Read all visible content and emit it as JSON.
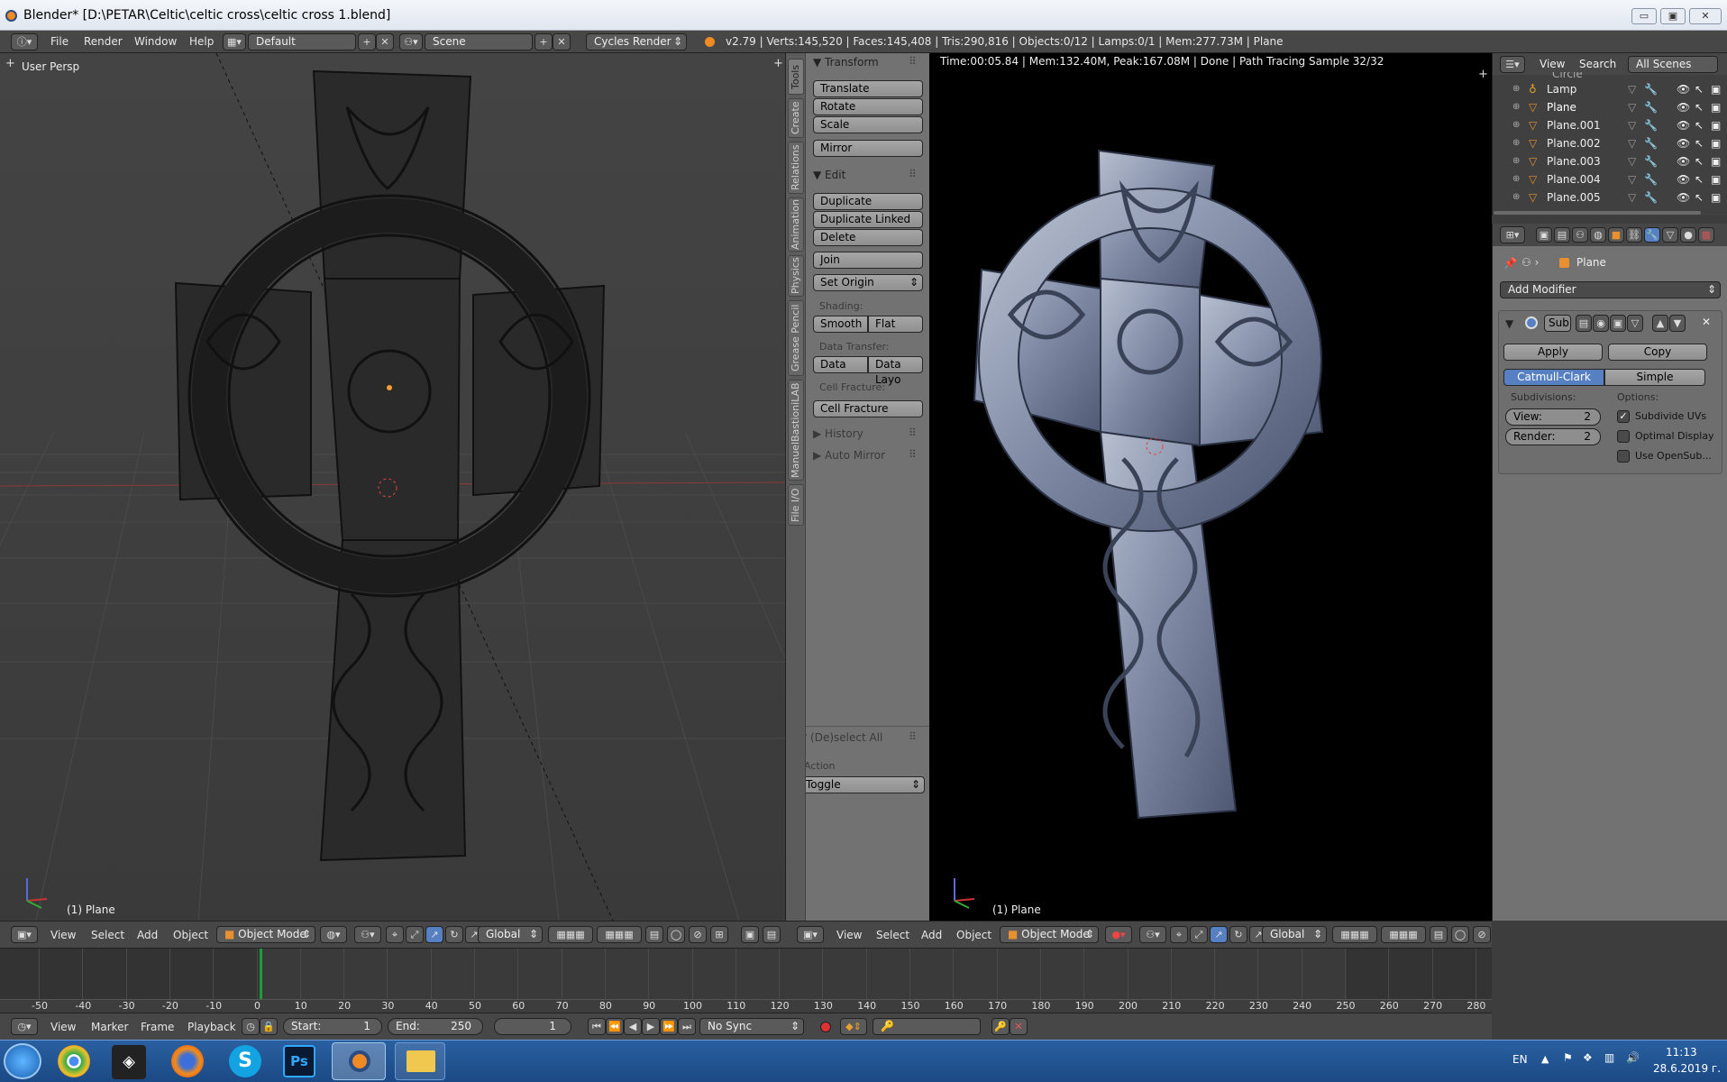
{
  "window": {
    "title": "Blender* [D:\\PETAR\\Celtic\\celtic cross\\celtic cross 1.blend]",
    "minimize": "▭",
    "maximize": "▣",
    "close": "✕"
  },
  "infobar": {
    "menus": [
      "File",
      "Render",
      "Window",
      "Help"
    ],
    "layout": "Default",
    "scene": "Scene",
    "engine": "Cycles Render",
    "stats": "v2.79 | Verts:145,520 | Faces:145,408 | Tris:290,816 | Objects:0/12 | Lamps:0/1 | Mem:277.73M | Plane"
  },
  "viewport_left": {
    "label": "User Persp",
    "object": "(1) Plane"
  },
  "viewport_right": {
    "render_status": "Time:00:05.84 | Mem:132.40M, Peak:167.08M | Done | Path Tracing Sample 32/32",
    "object": "(1) Plane"
  },
  "tool_tabs": [
    "Tools",
    "Create",
    "Relations",
    "Animation",
    "Physics",
    "Grease Pencil",
    "ManuelBastioniLAB",
    "File I/O"
  ],
  "toolshelf": {
    "transform_title": "Transform",
    "translate": "Translate",
    "rotate": "Rotate",
    "scale": "Scale",
    "mirror": "Mirror",
    "edit_title": "Edit",
    "duplicate": "Duplicate",
    "duplicate_linked": "Duplicate Linked",
    "delete": "Delete",
    "join": "Join",
    "set_origin": "Set Origin",
    "shading_label": "Shading:",
    "smooth": "Smooth",
    "flat": "Flat",
    "data_transfer_label": "Data Transfer:",
    "data": "Data",
    "data_layo": "Data Layo",
    "cell_fracture_label": "Cell Fracture:",
    "cell_fracture": "Cell Fracture",
    "history": "History",
    "auto_mirror": "Auto Mirror",
    "deselect_title": "(De)select All",
    "action_label": "Action",
    "action_value": "Toggle"
  },
  "outliner": {
    "view": "View",
    "search": "Search",
    "scenes": "All Scenes",
    "partial_item": "Circle",
    "items": [
      {
        "name": "Lamp",
        "icon": "lamp-icon",
        "color": "#e0a030"
      },
      {
        "name": "Plane",
        "icon": "mesh-icon",
        "color": "#e89030"
      },
      {
        "name": "Plane.001",
        "icon": "mesh-icon",
        "color": "#e89030"
      },
      {
        "name": "Plane.002",
        "icon": "mesh-icon",
        "color": "#e89030"
      },
      {
        "name": "Plane.003",
        "icon": "mesh-icon",
        "color": "#e89030"
      },
      {
        "name": "Plane.004",
        "icon": "mesh-icon",
        "color": "#e89030"
      },
      {
        "name": "Plane.005",
        "icon": "mesh-icon",
        "color": "#e89030"
      }
    ]
  },
  "properties": {
    "object_name": "Plane",
    "add_modifier": "Add Modifier",
    "modifier_name": "Sub",
    "apply": "Apply",
    "copy": "Copy",
    "catmull_clark": "Catmull-Clark",
    "simple": "Simple",
    "subdivisions_label": "Subdivisions:",
    "options_label": "Options:",
    "view_label": "View:",
    "view_value": "2",
    "render_label": "Render:",
    "render_value": "2",
    "subdivide_uvs": "Subdivide UVs",
    "subdivide_uvs_checked": true,
    "optimal_display": "Optimal Display",
    "use_opensub": "Use OpenSub..."
  },
  "viewport_header": {
    "menus": [
      "View",
      "Select",
      "Add",
      "Object"
    ],
    "mode": "Object Mode",
    "orientation": "Global"
  },
  "timeline": {
    "ticks": [
      "-50",
      "-40",
      "-30",
      "-20",
      "-10",
      "0",
      "10",
      "20",
      "30",
      "40",
      "50",
      "60",
      "70",
      "80",
      "90",
      "100",
      "110",
      "120",
      "130",
      "140",
      "150",
      "160",
      "170",
      "180",
      "190",
      "200",
      "210",
      "220",
      "230",
      "240",
      "250",
      "260",
      "270",
      "280"
    ],
    "current_frame_marker": 0,
    "menus": [
      "View",
      "Marker",
      "Frame",
      "Playback"
    ],
    "start_label": "Start:",
    "start_value": "1",
    "end_label": "End:",
    "end_value": "250",
    "current": "1",
    "sync": "No Sync"
  },
  "taskbar": {
    "lang": "EN",
    "time": "11:13",
    "date": "28.6.2019 г.",
    "apps": [
      "chrome",
      "unity",
      "firefox",
      "skype",
      "photoshop",
      "blender",
      "explorer"
    ]
  },
  "colors": {
    "accent_blue": "#5680c2",
    "stone": "#8a93a8",
    "active_frame": "#1a9e3a"
  }
}
